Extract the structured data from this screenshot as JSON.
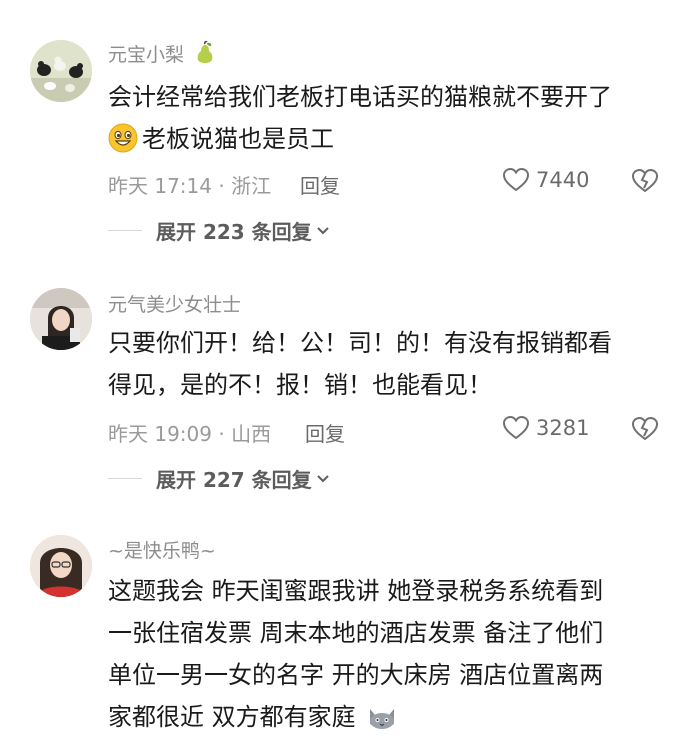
{
  "comments": [
    {
      "author": "元宝小梨",
      "author_badge_icon": "pear-icon",
      "text_line1": "会计经常给我们老板打电话买的猫粮就不要开了",
      "text_line2_emoji_icon": "grinning-face-icon",
      "text_line2": "老板说猫也是员工",
      "meta": "昨天 17:14 · 浙江",
      "reply_label": "回复",
      "likes": "7440",
      "expand_label": "展开 223 条回复"
    },
    {
      "author": "元气美少女壮士",
      "text_line1": "只要你们开！给！公！司！的！有没有报销都看",
      "text_line2": "得见，是的不！报！销！也能看见！",
      "meta": "昨天 19:09 · 山西",
      "reply_label": "回复",
      "likes": "3281",
      "expand_label": "展开 227 条回复"
    },
    {
      "author": "~是快乐鸭~",
      "text_lines": [
        "这题我会 昨天闺蜜跟我讲 她登录税务系统看到",
        "一张住宿发票 周末本地的酒店发票 备注了他们",
        "单位一男一女的名字 开的大床房 酒店位置离两",
        "家都很近 双方都有家庭"
      ],
      "trailing_emoji_icon": "cat-face-icon"
    }
  ],
  "colors": {
    "text": "#1a1a1a",
    "muted": "#9a9a9a",
    "author": "#8d8d8d"
  }
}
